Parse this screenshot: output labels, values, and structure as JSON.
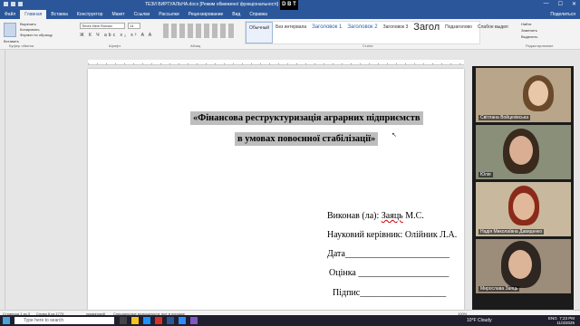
{
  "window": {
    "title": "ТЕЗИ ВИРТУАЛЬНА.docx [Режим обмеженої функціональності] - Word",
    "controls": [
      "—",
      "☐",
      "✕"
    ]
  },
  "ribbon_tabs": [
    "Файл",
    "Главная",
    "Вставка",
    "Конструктор",
    "Макет",
    "Ссылки",
    "Рассылки",
    "Рецензирование",
    "Вид",
    "Справка"
  ],
  "active_tab": "Главная",
  "share_label": "Поделиться",
  "clipboard": {
    "paste": "Вставить",
    "cut": "Вырезать",
    "copy": "Копировать",
    "format": "Формат по образцу"
  },
  "font": {
    "family": "Times New Roman",
    "size": "14",
    "format_row": "Ж К Ч abc x₂ x² A A"
  },
  "styles": [
    {
      "label": "Обычный",
      "kind": "sel"
    },
    {
      "label": "Без интервала",
      "kind": ""
    },
    {
      "label": "Заголовок 1",
      "kind": "h"
    },
    {
      "label": "Заголовок 2",
      "kind": "h"
    },
    {
      "label": "Заголовок 3",
      "kind": ""
    },
    {
      "label": "Загол",
      "kind": "big"
    },
    {
      "label": "Подзаголово",
      "kind": ""
    },
    {
      "label": "Слабое выдел",
      "kind": ""
    }
  ],
  "editing": {
    "find": "Найти",
    "replace": "Заменить",
    "select": "Выделить"
  },
  "group_labels": [
    "Буфер обмена",
    "Шрифт",
    "Абзац",
    "Стили",
    "Редактирование"
  ],
  "document": {
    "title_line1": "«Фінансова реструктуризація аграрних підприємств",
    "title_line2": "в умовах повоєнної стабілізації»",
    "author_label": "Виконав (ла):",
    "author_name": "Заяць",
    "author_initials": "М.С.",
    "supervisor": "Науковий керівник: Олійник Л.А.",
    "date": "Дата_______________________",
    "grade": "Оцінка ____________________",
    "signature": "Підпис___________________"
  },
  "participants": [
    {
      "name": "Світлана Войцехівська"
    },
    {
      "name": "Юлія"
    },
    {
      "name": "Надія Миколаївна Давиденко"
    },
    {
      "name": "Мирослава Заяць"
    }
  ],
  "statusbar": {
    "page": "Страница 1 из 3",
    "words": "Слово 8 из 1779",
    "lang": "украинский",
    "accessibility": "Специальные возможности: все в порядке",
    "zoom": "100%"
  },
  "taskbar": {
    "search_placeholder": "Type here to search",
    "weather": "10°F Cloudy",
    "lang": "ENG",
    "time": "7:23 PM",
    "date": "11/3/2025"
  },
  "logo": {
    "text": "D B T"
  }
}
